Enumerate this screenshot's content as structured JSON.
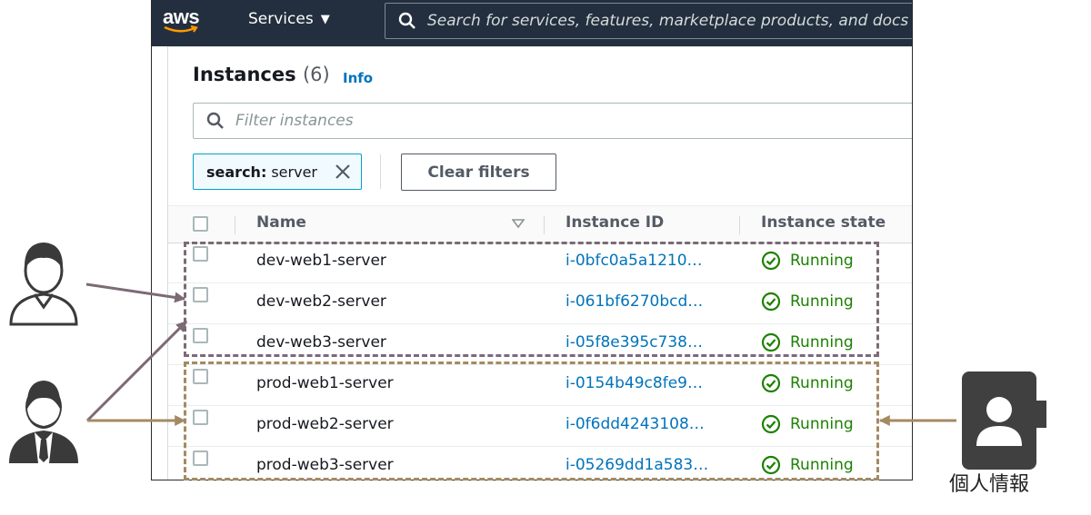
{
  "header": {
    "logo_text": "aws",
    "services_label": "Services",
    "search_placeholder": "Search for services, features, marketplace products, and docs"
  },
  "panel": {
    "title": "Instances",
    "count": "(6)",
    "info_label": "Info",
    "filter_placeholder": "Filter instances",
    "token_key": "search:",
    "token_value": "server",
    "clear_filters_label": "Clear filters"
  },
  "table": {
    "columns": [
      "Name",
      "Instance ID",
      "Instance state"
    ],
    "rows": [
      {
        "name": "dev-web1-server",
        "id": "i-0bfc0a5a1210…",
        "state": "Running"
      },
      {
        "name": "dev-web2-server",
        "id": "i-061bf6270bcd…",
        "state": "Running"
      },
      {
        "name": "dev-web3-server",
        "id": "i-05f8e395c738…",
        "state": "Running"
      },
      {
        "name": "prod-web1-server",
        "id": "i-0154b49c8fe9…",
        "state": "Running"
      },
      {
        "name": "prod-web2-server",
        "id": "i-0f6dd4243108…",
        "state": "Running"
      },
      {
        "name": "prod-web3-server",
        "id": "i-05269dd1a583…",
        "state": "Running"
      }
    ]
  },
  "annotation": {
    "personal_info_label": "個人情報",
    "dev_group_color": "#7c6a75",
    "prod_group_color": "#a48a63"
  },
  "colors": {
    "topbar": "#232f3e",
    "link": "#0073bb",
    "running": "#1d8102"
  }
}
